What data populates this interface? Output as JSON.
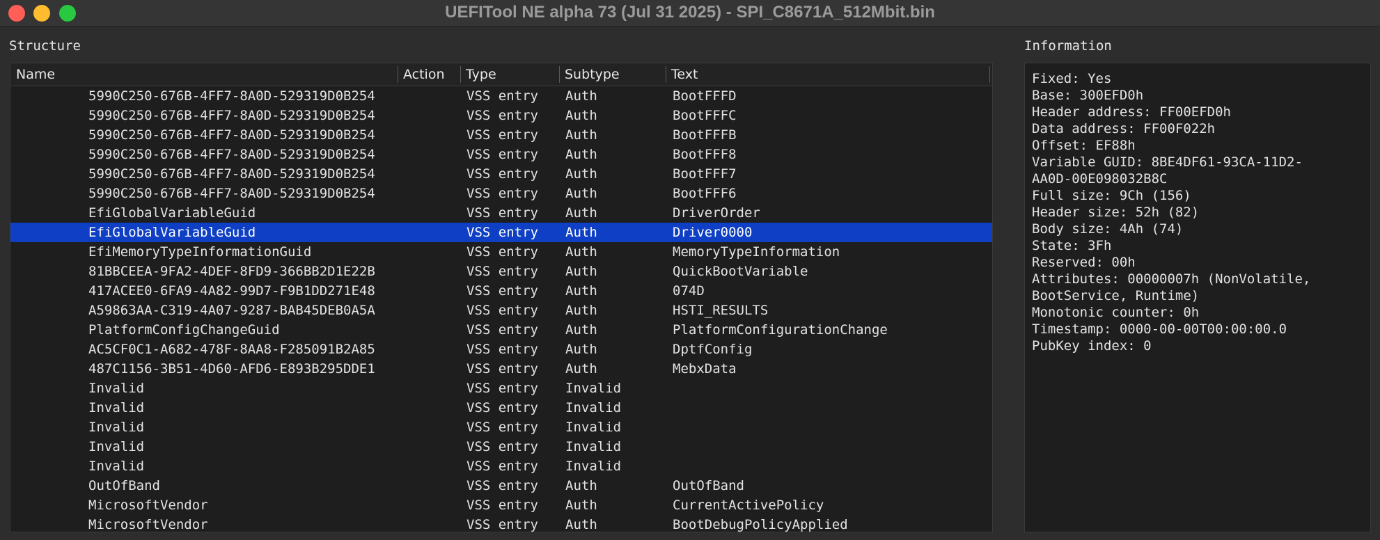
{
  "window": {
    "title": "UEFITool NE alpha 73 (Jul 31 2025) - SPI_C8671A_512Mbit.bin"
  },
  "structure": {
    "label": "Structure",
    "columns": {
      "name": "Name",
      "action": "Action",
      "type": "Type",
      "subtype": "Subtype",
      "text": "Text"
    },
    "rows": [
      {
        "name": "5990C250-676B-4FF7-8A0D-529319D0B254",
        "action": "",
        "type": "VSS entry",
        "subtype": "Auth",
        "text": "BootFFFD"
      },
      {
        "name": "5990C250-676B-4FF7-8A0D-529319D0B254",
        "action": "",
        "type": "VSS entry",
        "subtype": "Auth",
        "text": "BootFFFC"
      },
      {
        "name": "5990C250-676B-4FF7-8A0D-529319D0B254",
        "action": "",
        "type": "VSS entry",
        "subtype": "Auth",
        "text": "BootFFFB"
      },
      {
        "name": "5990C250-676B-4FF7-8A0D-529319D0B254",
        "action": "",
        "type": "VSS entry",
        "subtype": "Auth",
        "text": "BootFFF8"
      },
      {
        "name": "5990C250-676B-4FF7-8A0D-529319D0B254",
        "action": "",
        "type": "VSS entry",
        "subtype": "Auth",
        "text": "BootFFF7"
      },
      {
        "name": "5990C250-676B-4FF7-8A0D-529319D0B254",
        "action": "",
        "type": "VSS entry",
        "subtype": "Auth",
        "text": "BootFFF6"
      },
      {
        "name": "EfiGlobalVariableGuid",
        "action": "",
        "type": "VSS entry",
        "subtype": "Auth",
        "text": "DriverOrder"
      },
      {
        "name": "EfiGlobalVariableGuid",
        "action": "",
        "type": "VSS entry",
        "subtype": "Auth",
        "text": "Driver0000"
      },
      {
        "name": "EfiMemoryTypeInformationGuid",
        "action": "",
        "type": "VSS entry",
        "subtype": "Auth",
        "text": "MemoryTypeInformation"
      },
      {
        "name": "81BBCEEA-9FA2-4DEF-8FD9-366BB2D1E22B",
        "action": "",
        "type": "VSS entry",
        "subtype": "Auth",
        "text": "QuickBootVariable"
      },
      {
        "name": "417ACEE0-6FA9-4A82-99D7-F9B1DD271E48",
        "action": "",
        "type": "VSS entry",
        "subtype": "Auth",
        "text": "074D"
      },
      {
        "name": "A59863AA-C319-4A07-9287-BAB45DEB0A5A",
        "action": "",
        "type": "VSS entry",
        "subtype": "Auth",
        "text": "HSTI_RESULTS"
      },
      {
        "name": "PlatformConfigChangeGuid",
        "action": "",
        "type": "VSS entry",
        "subtype": "Auth",
        "text": "PlatformConfigurationChange"
      },
      {
        "name": "AC5CF0C1-A682-478F-8AA8-F285091B2A85",
        "action": "",
        "type": "VSS entry",
        "subtype": "Auth",
        "text": "DptfConfig"
      },
      {
        "name": "487C1156-3B51-4D60-AFD6-E893B295DDE1",
        "action": "",
        "type": "VSS entry",
        "subtype": "Auth",
        "text": "MebxData"
      },
      {
        "name": "Invalid",
        "action": "",
        "type": "VSS entry",
        "subtype": "Invalid",
        "text": ""
      },
      {
        "name": "Invalid",
        "action": "",
        "type": "VSS entry",
        "subtype": "Invalid",
        "text": ""
      },
      {
        "name": "Invalid",
        "action": "",
        "type": "VSS entry",
        "subtype": "Invalid",
        "text": ""
      },
      {
        "name": "Invalid",
        "action": "",
        "type": "VSS entry",
        "subtype": "Invalid",
        "text": ""
      },
      {
        "name": "Invalid",
        "action": "",
        "type": "VSS entry",
        "subtype": "Invalid",
        "text": ""
      },
      {
        "name": "OutOfBand",
        "action": "",
        "type": "VSS entry",
        "subtype": "Auth",
        "text": "OutOfBand"
      },
      {
        "name": "MicrosoftVendor",
        "action": "",
        "type": "VSS entry",
        "subtype": "Auth",
        "text": "CurrentActivePolicy"
      },
      {
        "name": "MicrosoftVendor",
        "action": "",
        "type": "VSS entry",
        "subtype": "Auth",
        "text": "BootDebugPolicyApplied"
      }
    ],
    "selected_index": 7
  },
  "information": {
    "label": "Information",
    "lines": [
      "Fixed: Yes",
      "Base: 300EFD0h",
      "Header address: FF00EFD0h",
      "Data address: FF00F022h",
      "Offset: EF88h",
      "Variable GUID: 8BE4DF61-93CA-11D2-",
      "AA0D-00E098032B8C",
      "Full size: 9Ch (156)",
      "Header size: 52h (82)",
      "Body size: 4Ah (74)",
      "State: 3Fh",
      "Reserved: 00h",
      "Attributes: 00000007h (NonVolatile,",
      "BootService, Runtime)",
      "Monotonic counter: 0h",
      "Timestamp: 0000-00-00T00:00:00.0",
      "PubKey index: 0"
    ]
  },
  "colors": {
    "selection": "#0e3fc4",
    "close": "#ff5f57",
    "minimize": "#febc2e",
    "maximize": "#28c840"
  }
}
